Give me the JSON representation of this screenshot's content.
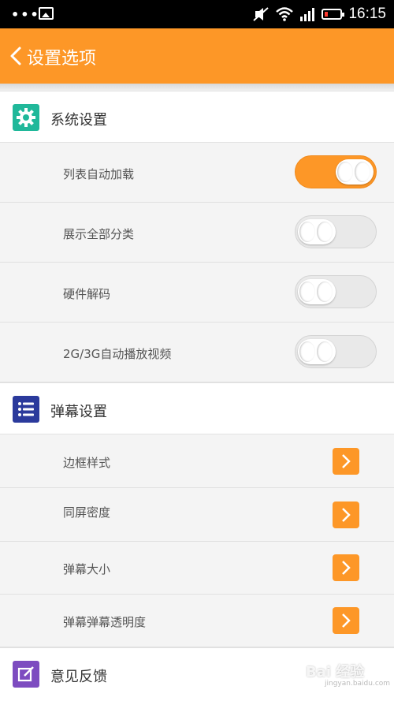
{
  "status_bar": {
    "time": "16:15",
    "icons": [
      "more-dots-icon",
      "image-icon",
      "mute-icon",
      "wifi-icon",
      "signal-icon",
      "battery-low-icon"
    ]
  },
  "app_bar": {
    "title": "设置选项",
    "back_icon": "chevron-left-icon"
  },
  "colors": {
    "accent": "#fd9727",
    "system_icon_bg": "#20b89a",
    "danmaku_icon_bg": "#2b3a9c",
    "feedback_icon_bg": "#7d4cc0"
  },
  "sections": {
    "system": {
      "title": "系统设置",
      "icon": "gear-icon",
      "items": [
        {
          "label": "列表自动加载",
          "toggle_on": true
        },
        {
          "label": "展示全部分类",
          "toggle_on": false
        },
        {
          "label": "硬件解码",
          "toggle_on": false
        },
        {
          "label": "2G/3G自动播放视频",
          "toggle_on": false
        }
      ]
    },
    "danmaku": {
      "title": "弹幕设置",
      "icon": "list-icon",
      "items": [
        {
          "label": "边框样式",
          "action_icon": "chevron-right-icon"
        },
        {
          "label": "同屏密度",
          "action_icon": "chevron-right-icon"
        },
        {
          "label": "弹幕大小",
          "action_icon": "chevron-right-icon"
        },
        {
          "label": "弹幕弹幕透明度",
          "action_icon": "chevron-right-icon"
        }
      ]
    },
    "feedback": {
      "title": "意见反馈",
      "icon": "edit-icon"
    }
  },
  "watermark": {
    "text": "Bai 经验",
    "sub": "jingyan.baidu.com"
  }
}
